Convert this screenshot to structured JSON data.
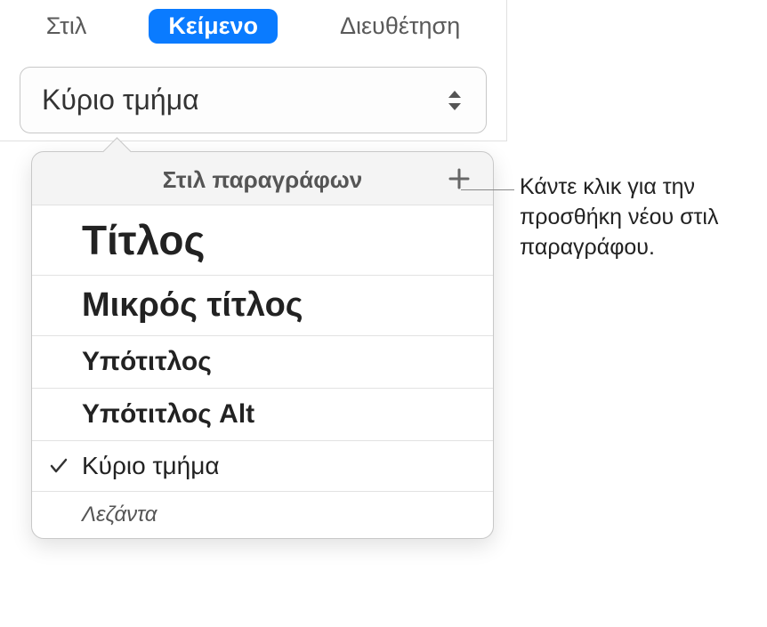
{
  "tabs": {
    "style": "Στιλ",
    "text": "Κείμενο",
    "arrange": "Διευθέτηση"
  },
  "styleSelect": {
    "current": "Κύριο τμήμα"
  },
  "popover": {
    "title": "Στιλ παραγράφων",
    "items": {
      "title": "Τίτλος",
      "smallTitle": "Μικρός τίτλος",
      "subtitle": "Υπότιτλος",
      "subtitleAlt": "Υπότιτλος Alt",
      "body": "Κύριο τμήμα",
      "caption": "Λεζάντα"
    }
  },
  "callout": {
    "text": "Κάντε κλικ για την προσθήκη νέου στιλ παραγράφου."
  }
}
